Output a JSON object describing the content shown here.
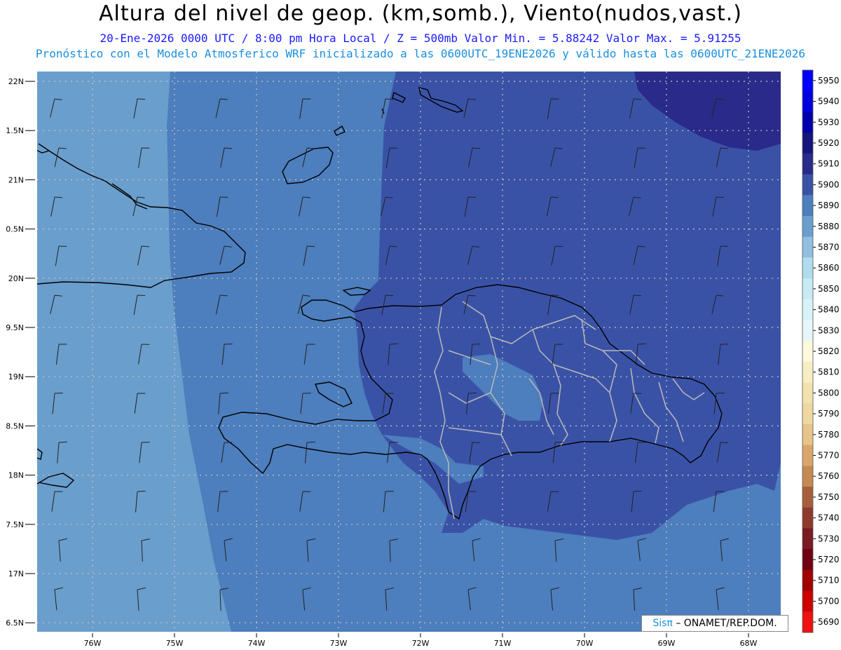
{
  "title": "Altura del nivel de geop. (km,somb.), Viento(nudos,vast.)",
  "subtitle_line1": "20-Ene-2026  0000 UTC / 8:00 pm Hora Local / Z = 500mb     Valor Min. = 5.88242  Valor Max. = 5.91255",
  "subtitle_line2": "Pronóstico con el Modelo Atmosferico WRF inicializado a las 0600UTC_19ENE2026 y válido hasta las  0600UTC_21ENE2026",
  "lat_labels": [
    "22N",
    "1.5N",
    "21N",
    "0.5N",
    "20N",
    "9.5N",
    "19N",
    "8.5N",
    "18N",
    "7.5N",
    "17N",
    "6.5N"
  ],
  "lon_labels": [
    "76W",
    "75W",
    "74W",
    "73W",
    "72W",
    "71W",
    "70W",
    "69W",
    "68W"
  ],
  "colorbar": {
    "levels": [
      "5950",
      "5940",
      "5930",
      "5920",
      "5910",
      "5900",
      "5890",
      "5880",
      "5870",
      "5860",
      "5850",
      "5840",
      "5830",
      "5820",
      "5810",
      "5800",
      "5790",
      "5780",
      "5770",
      "5760",
      "5750",
      "5740",
      "5730",
      "5720",
      "5710",
      "5700",
      "5690"
    ],
    "colors": [
      "#0000ff",
      "#0000dd",
      "#0000aa",
      "#14147a",
      "#2a2a8a",
      "#3a52a6",
      "#4d7ebd",
      "#6a9ecc",
      "#90bfe0",
      "#b0dcef",
      "#c7eaf5",
      "#d8f2fa",
      "#e6f7fc",
      "#fff8dc",
      "#f8eec4",
      "#f2e2ae",
      "#eed8a0",
      "#e6c48a",
      "#d8a66a",
      "#c48a52",
      "#a85e3e",
      "#8f3a2e",
      "#7a1a22",
      "#6e0010",
      "#a00000",
      "#cc0000",
      "#ee1111"
    ]
  },
  "field_colors": {
    "zone_5880": "#6a9ecc",
    "zone_5890": "#4d7ebd",
    "zone_5900": "#3a52a6",
    "zone_5910": "#2a2a8a"
  },
  "credit": {
    "brand": "Sisπ",
    "text": "– ONAMET/REP.DOM."
  }
}
